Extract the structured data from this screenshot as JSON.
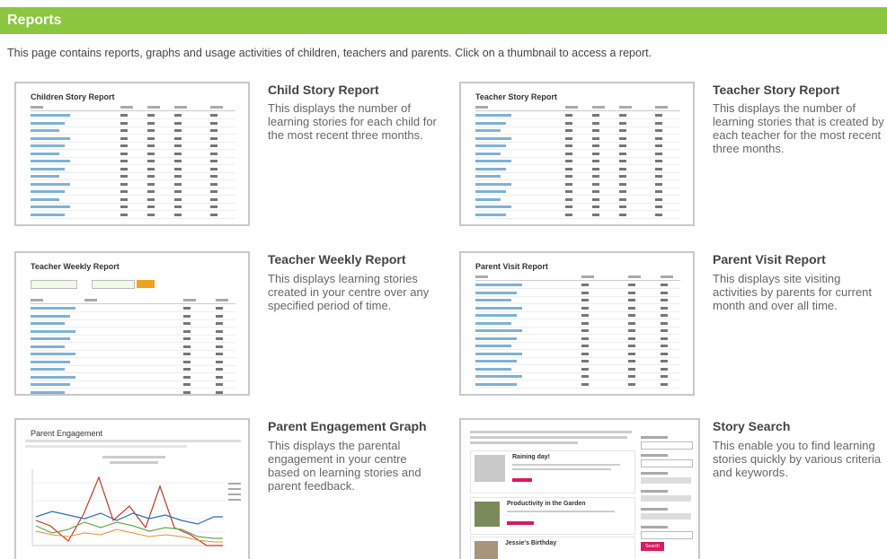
{
  "header": {
    "title": "Reports"
  },
  "intro": "This page contains reports, graphs and usage activities of children, teachers and parents. Click on a thumbnail to access a report.",
  "reports": [
    {
      "title": "Child Story Report",
      "description": "This displays the number of learning stories for each child for the most recent three months.",
      "thumb_title": "Children Story Report"
    },
    {
      "title": "Teacher Story Report",
      "description": "This displays the number of learning stories that is created by each teacher for the most recent three months.",
      "thumb_title": "Teacher Story Report"
    },
    {
      "title": "Teacher Weekly Report",
      "description": "This displays learning stories created in your centre over any specified period of time.",
      "thumb_title": "Teacher Weekly Report"
    },
    {
      "title": "Parent Visit Report",
      "description": "This displays site visiting activities by parents for current month and over all time.",
      "thumb_title": "Parent Visit Report"
    },
    {
      "title": "Parent Engagement Graph",
      "description": "This displays the parental engagement in your centre based on learning stories and parent feedback.",
      "thumb_title": "Parent Engagement"
    },
    {
      "title": "Story Search",
      "description": "This enable you to find learning stories quickly by various criteria and keywords.",
      "thumb_stories": [
        "Raining day!",
        "Productivity in the Garden",
        "Jessie's Birthday"
      ],
      "thumb_search_button": "Search"
    }
  ],
  "colors": {
    "topbar": "#8cc63f",
    "link": "#5a9fd4",
    "accent": "#f0a020",
    "search_button": "#d81b60"
  }
}
